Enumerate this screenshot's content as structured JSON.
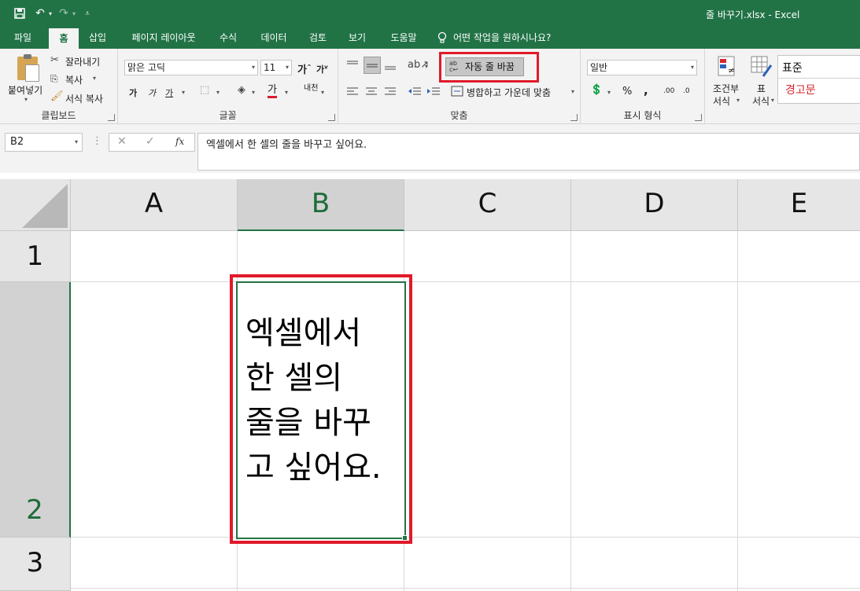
{
  "window": {
    "title": "줄 바꾸기.xlsx  -  Excel"
  },
  "qat": {
    "save": "save-icon",
    "undo": "undo-icon",
    "redo": "redo-icon",
    "customize": "customize-icon"
  },
  "tabs": [
    {
      "label": "파일"
    },
    {
      "label": "홈"
    },
    {
      "label": "삽입"
    },
    {
      "label": "페이지 레이아웃"
    },
    {
      "label": "수식"
    },
    {
      "label": "데이터"
    },
    {
      "label": "검토"
    },
    {
      "label": "보기"
    },
    {
      "label": "도움말"
    }
  ],
  "tellme": {
    "text": "어떤 작업을 원하시나요?"
  },
  "clipboard": {
    "paste": "붙여넣기",
    "cut": "잘라내기",
    "copy": "복사",
    "format_painter": "서식 복사",
    "label": "클립보드"
  },
  "font": {
    "name": "맑은 고딕",
    "size": "11",
    "grow": "가",
    "shrink": "가",
    "bold": "가",
    "italic": "가",
    "underline": "가",
    "color_letter": "가",
    "phonetic": "내천",
    "label": "글꼴"
  },
  "alignment": {
    "wrap_text": "자동 줄 바꿈",
    "merge_center": "병합하고 가운데 맞춤",
    "label": "맞춤"
  },
  "number": {
    "format": "일반",
    "label": "표시 형식",
    "percent": "%",
    "comma": ",",
    "inc_decimal": ".00",
    "dec_decimal": ".0"
  },
  "styles": {
    "conditional": [
      "조건부",
      "서식"
    ],
    "table": [
      "표",
      "서식"
    ],
    "normal": "표준",
    "warning": "경고문"
  },
  "formula_bar": {
    "name_box": "B2",
    "content": "엑셀에서 한 셀의 줄을 바꾸고 싶어요.",
    "fx": "fx"
  },
  "grid": {
    "columns": [
      "A",
      "B",
      "C",
      "D",
      "E"
    ],
    "rows": [
      "1",
      "2",
      "3"
    ],
    "cell_b2_lines": [
      "엑셀에서",
      "한 셀의",
      "줄을 바꾸",
      "고 싶어요."
    ]
  },
  "colors": {
    "accent": "#217346",
    "highlight": "#e01a2a",
    "warning_text": "#d8262e"
  }
}
